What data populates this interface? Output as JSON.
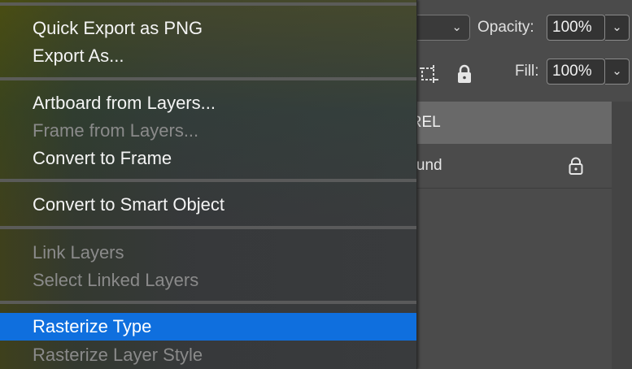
{
  "layers_panel": {
    "opacity_label": "Opacity:",
    "opacity_value": "100%",
    "fill_label": "Fill:",
    "fill_value": "100%",
    "chevron": "⌄",
    "group_layer_name": "RREL",
    "background_layer_name": "round"
  },
  "menu": {
    "items": [
      {
        "label": "Quick Export as PNG",
        "state": "enabled"
      },
      {
        "label": "Export As...",
        "state": "enabled"
      },
      {
        "label": "Artboard from Layers...",
        "state": "enabled"
      },
      {
        "label": "Frame from Layers...",
        "state": "disabled"
      },
      {
        "label": "Convert to Frame",
        "state": "enabled"
      },
      {
        "label": "Convert to Smart Object",
        "state": "enabled"
      },
      {
        "label": "Link Layers",
        "state": "disabled"
      },
      {
        "label": "Select Linked Layers",
        "state": "disabled"
      },
      {
        "label": "Rasterize Type",
        "state": "selected"
      },
      {
        "label": "Rasterize Layer Style",
        "state": "disabled"
      }
    ]
  },
  "colors": {
    "selection": "#0f6fde",
    "menu_text": "#f4f4f4",
    "disabled_text": "#8a8a8a",
    "panel_bg": "#4b4b4b",
    "selected_layer_bg": "#696969"
  }
}
